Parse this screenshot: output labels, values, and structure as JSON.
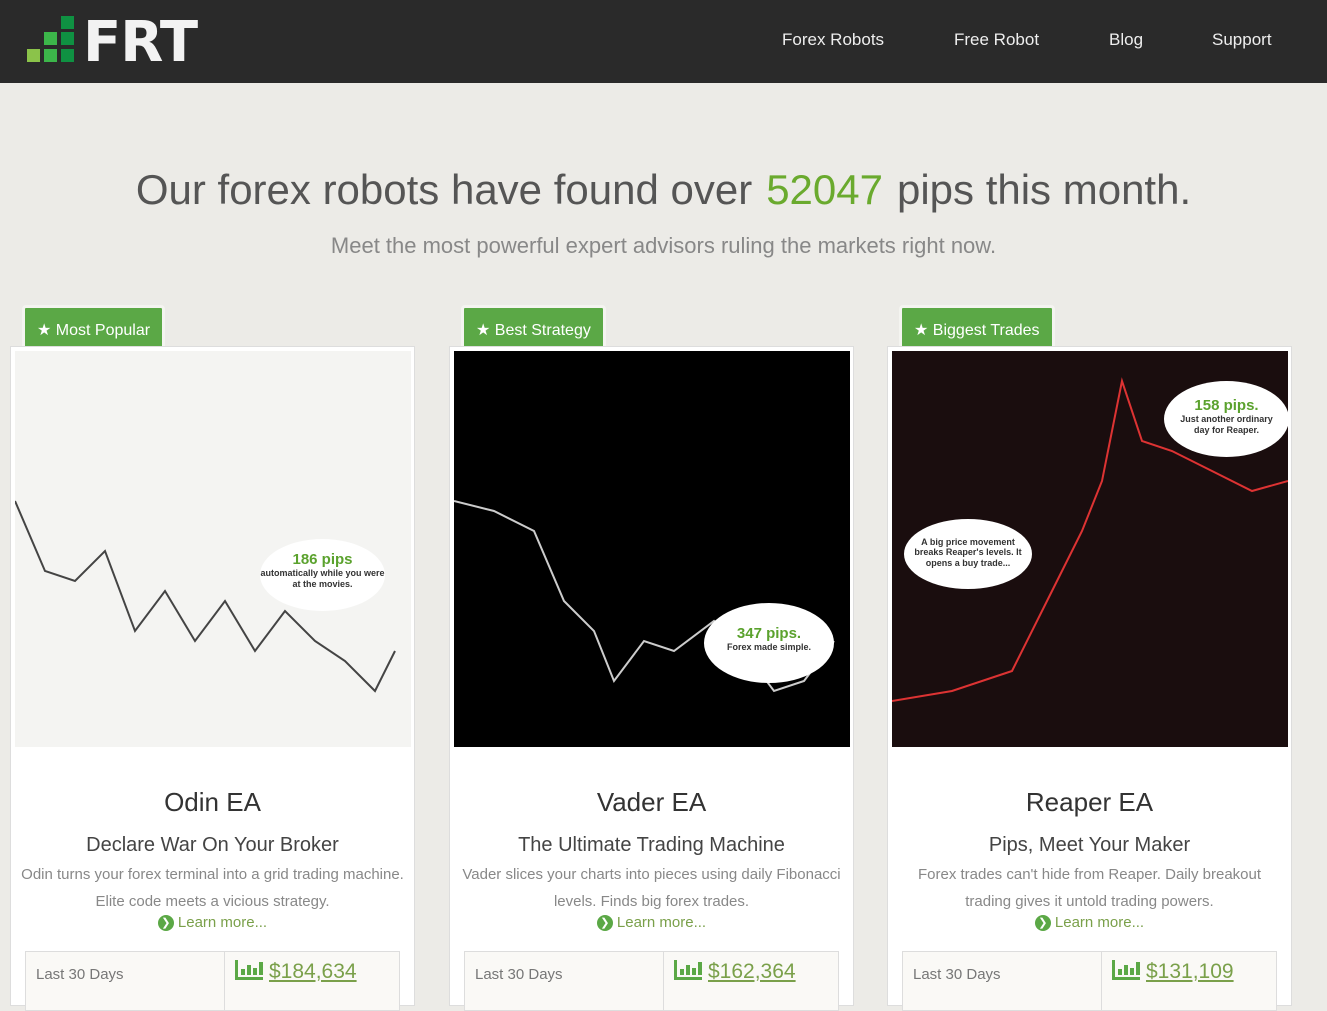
{
  "header": {
    "logo": "FRT",
    "nav": [
      "Forex Robots",
      "Free Robot",
      "Blog",
      "Support"
    ]
  },
  "hero": {
    "title_before": "Our forex robots have found over",
    "pips": "52047",
    "title_after": "pips this month.",
    "subtitle": "Meet the most powerful expert advisors ruling the markets right now."
  },
  "colors": {
    "accent": "#5ba846",
    "header": "#2a2a2a",
    "background": "#ecebe7"
  },
  "cards": [
    {
      "badge": "Most Popular",
      "badge_icon": "star-icon",
      "name": "Odin EA",
      "tagline": "Declare War On Your Broker",
      "description": "Odin turns your forex terminal into a grid trading machine. Elite code meets a vicious strategy.",
      "learn_more": "Learn more...",
      "stat_label": "Last 30 Days",
      "stat_value": "$184,634",
      "bubble_title": "186 pips",
      "bubble_text": "automatically while you were at the movies."
    },
    {
      "badge": "Best Strategy",
      "badge_icon": "star-icon",
      "name": "Vader EA",
      "tagline": "The Ultimate Trading Machine",
      "description": "Vader slices your charts into pieces using daily Fibonacci levels. Finds big forex trades.",
      "learn_more": "Learn more...",
      "stat_label": "Last 30 Days",
      "stat_value": "$162,364",
      "bubble_title": "347 pips.",
      "bubble_text": "Forex made simple."
    },
    {
      "badge": "Biggest Trades",
      "badge_icon": "star-icon",
      "name": "Reaper EA",
      "tagline": "Pips, Meet Your Maker",
      "description": "Forex trades can't hide from Reaper. Daily breakout trading gives it untold trading powers.",
      "learn_more": "Learn more...",
      "stat_label": "Last 30 Days",
      "stat_value": "$131,109",
      "bubble_title": "158 pips.",
      "bubble_text": "Just another ordinary day for Reaper.",
      "bubble2_text": "A big price movement breaks Reaper's levels. It opens a buy trade..."
    }
  ]
}
